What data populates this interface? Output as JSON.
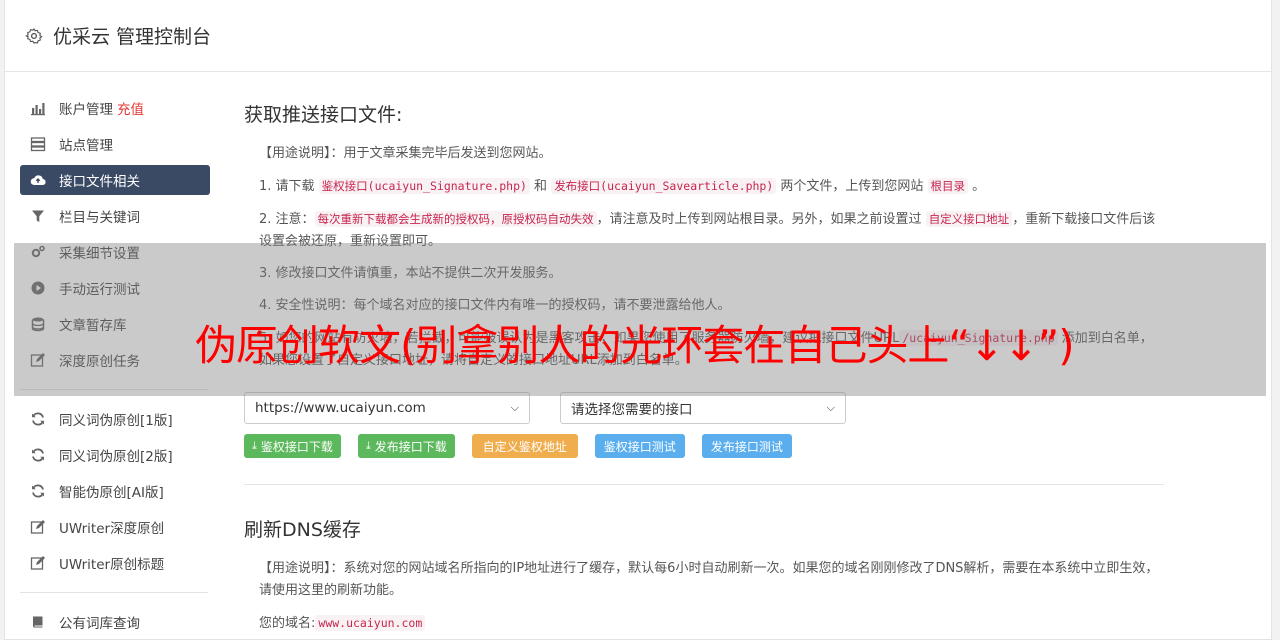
{
  "header": {
    "title": "优采云 管理控制台"
  },
  "sidebar": {
    "items": [
      {
        "label": "账户管理",
        "badge": "充值"
      },
      {
        "label": "站点管理"
      },
      {
        "label": "接口文件相关"
      },
      {
        "label": "栏目与关键词"
      },
      {
        "label": "采集细节设置"
      },
      {
        "label": "手动运行测试"
      },
      {
        "label": "文章暂存库"
      },
      {
        "label": "深度原创任务"
      },
      {
        "label": "同义词伪原创[1版]"
      },
      {
        "label": "同义词伪原创[2版]"
      },
      {
        "label": "智能伪原创[AI版]"
      },
      {
        "label": "UWriter深度原创"
      },
      {
        "label": "UWriter原创标题"
      },
      {
        "label": "公有词库查询"
      }
    ]
  },
  "section1": {
    "title": "获取推送接口文件:",
    "usage_prefix": "【用途说明】：用于文章采集完毕后发送到您网站。",
    "step1": {
      "a": "1. 请下载 ",
      "code1": "鉴权接口(ucaiyun_Signature.php)",
      "b": " 和 ",
      "code2": "发布接口(ucaiyun_Savearticle.php)",
      "c": " 两个文件，上传到您网站 ",
      "code3": "根目录",
      "d": " 。"
    },
    "step2": {
      "a": "2. 注意：",
      "code1": "每次重新下载都会生成新的授权码，原授权码自动失效",
      "b": "，请注意及时上传到网站根目录。另外，如果之前设置过 ",
      "code2": "自定义接口地址",
      "c": "，重新下载接口文件后该设置会被还原，重新设置即可。"
    },
    "step3": "3. 修改接口文件请慎重，本站不提供二次开发服务。",
    "step4": "4. 安全性说明：每个域名对应的接口文件内有唯一的授权码，请不要泄露给他人。",
    "step5": {
      "a": "5. 如您的网站有防火墙，若拦截，可能被误认为是黑客攻击，如果您使用了服务器防火墙，建议把接口文件URL",
      "code1": "/ucaiyun_Signature.php",
      "b": " 添加到白名单，如果您设置了自定义接口地址，请将自定义的接口地址URL添加到白名单。"
    },
    "site_select": "https://www.ucaiyun.com",
    "interface_select": "请选择您需要的接口",
    "buttons": {
      "sig_download": "鉴权接口下载",
      "pub_download": "发布接口下载",
      "custom": "自定义鉴权地址",
      "sig_test": "鉴权接口测试",
      "pub_test": "发布接口测试"
    }
  },
  "section2": {
    "title": "刷新DNS缓存",
    "usage": "【用途说明】：系统对您的网站域名所指向的IP地址进行了缓存，默认每6小时自动刷新一次。如果您的域名刚刚修改了DNS解析，需要在本系统中立即生效，请使用这里的刷新功能。",
    "domain_label": "您的域名:",
    "domain_value": "www.ucaiyun.com"
  },
  "overlay": {
    "text": "伪原创软文(别拿别人的光环套在自己头上“↓↓”)"
  },
  "colors": {
    "active_nav": "#3b4a64",
    "badge": "#e53935",
    "green": "#5cb85c",
    "orange": "#f0ad4e",
    "blue": "#5aaeee",
    "code": "#c7254e",
    "overlay_text": "#ff0000"
  }
}
